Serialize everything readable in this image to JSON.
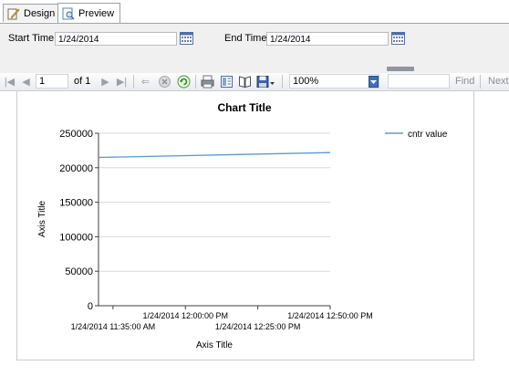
{
  "tabs": [
    {
      "label": "Design",
      "icon": "design-icon"
    },
    {
      "label": "Preview",
      "icon": "preview-icon"
    }
  ],
  "parameters": {
    "start_time": {
      "label": "Start Time",
      "value": "1/24/2014"
    },
    "end_time": {
      "label": "End Time",
      "value": "1/24/2014"
    }
  },
  "toolbar": {
    "page_value": "1",
    "of_label": "of 1",
    "zoom_value": "100%",
    "find_label": "Find",
    "next_label": "Next"
  },
  "colors": {
    "series_line": "#5b9bd5",
    "legend_line": "#5b9bd5",
    "axis": "#404040",
    "grid": "#d9d9d9"
  },
  "chart_data": {
    "type": "line",
    "title": "Chart Title",
    "xlabel": "Axis Title",
    "ylabel": "Axis Title",
    "ylim": [
      0,
      250000
    ],
    "yticks": [
      "0",
      "50000",
      "100000",
      "150000",
      "200000",
      "250000"
    ],
    "xticks": [
      "1/24/2014 11:35:00 AM",
      "1/24/2014 12:00:00 PM",
      "1/24/2014 12:25:00 PM",
      "1/24/2014 12:50:00 PM"
    ],
    "grid": true,
    "legend": "top-right",
    "series": [
      {
        "name": "cntr value",
        "x": [
          "1/24/2014 11:30:00 AM",
          "1/24/2014 12:50:00 PM"
        ],
        "values": [
          215000,
          222000
        ]
      }
    ]
  }
}
